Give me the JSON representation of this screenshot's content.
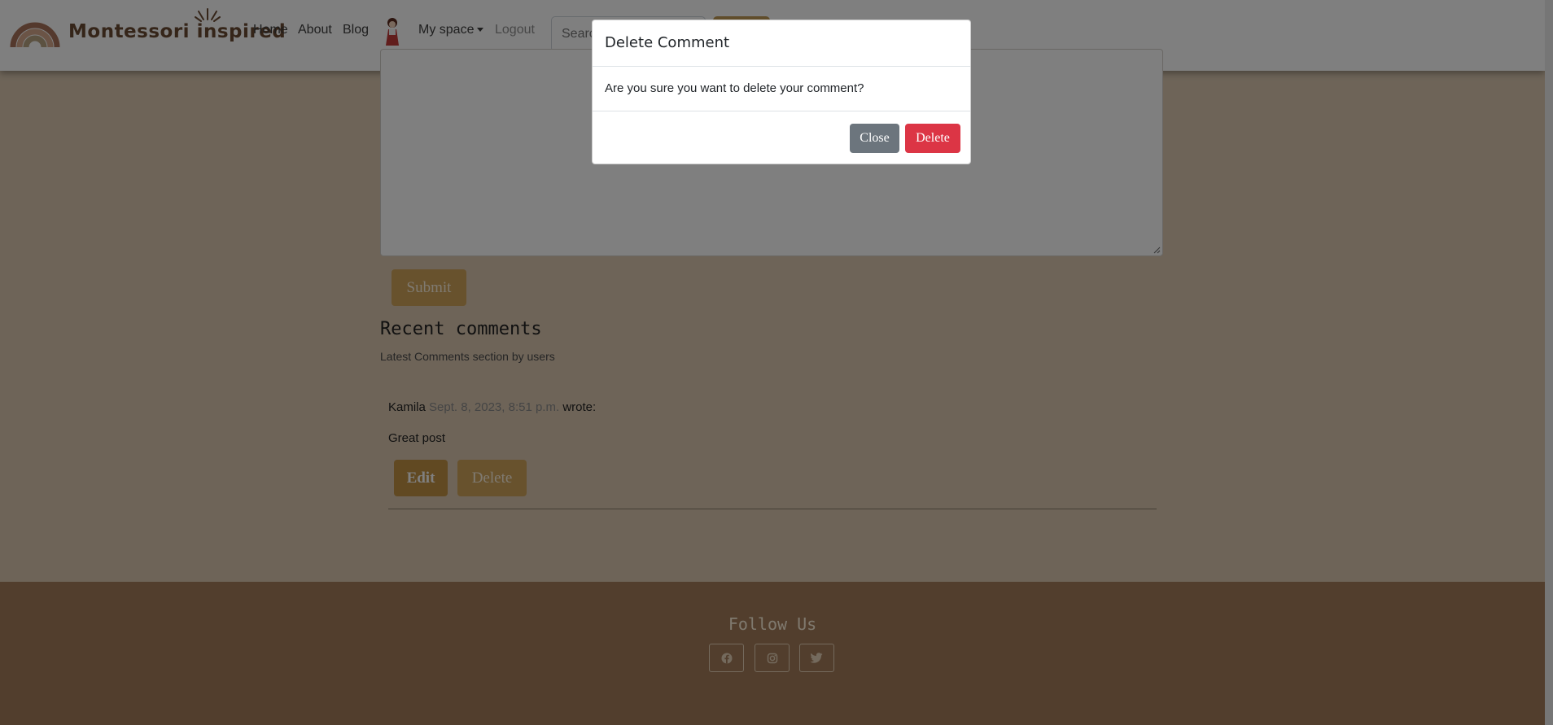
{
  "brand": {
    "name": "Montessori inspired"
  },
  "nav": {
    "home": "Home",
    "about": "About",
    "blog": "Blog",
    "my_space": "My space",
    "logout": "Logout"
  },
  "search": {
    "placeholder": "Search"
  },
  "comment_form": {
    "submit_label": "Submit"
  },
  "comments_section": {
    "title": "Recent comments",
    "subtitle": "Latest Comments section by users",
    "items": [
      {
        "author": "Kamila",
        "date": "Sept. 8, 2023, 8:51 p.m.",
        "wrote": "wrote:",
        "body": "Great post",
        "edit_label": "Edit",
        "delete_label": "Delete"
      }
    ]
  },
  "footer": {
    "title": "Follow Us",
    "social": [
      "facebook-icon",
      "instagram-icon",
      "twitter-icon"
    ]
  },
  "modal": {
    "title": "Delete Comment",
    "message": "Are you sure you want to delete your comment?",
    "close_label": "Close",
    "delete_label": "Delete"
  },
  "colors": {
    "accent": "#d0a45a",
    "accent_dark": "#c29245",
    "footer": "#a57c5a",
    "danger": "#dc3545",
    "secondary": "#6c757d"
  }
}
